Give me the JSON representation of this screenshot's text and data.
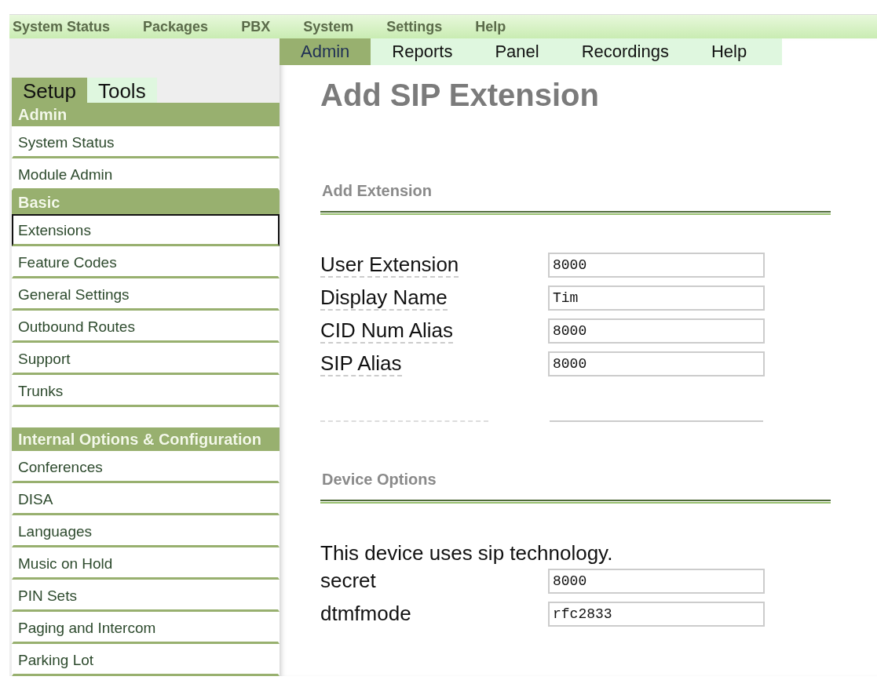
{
  "top_menu": [
    {
      "label": "System Status"
    },
    {
      "label": "Packages"
    },
    {
      "label": "PBX"
    },
    {
      "label": "System"
    },
    {
      "label": "Settings"
    },
    {
      "label": "Help"
    }
  ],
  "sub_menu": [
    {
      "label": "Admin",
      "selected": true
    },
    {
      "label": "Reports",
      "selected": false
    },
    {
      "label": "Panel",
      "selected": false
    },
    {
      "label": "Recordings",
      "selected": false
    },
    {
      "label": "Help",
      "selected": false
    }
  ],
  "sidebar": {
    "tabs": [
      {
        "label": "Setup",
        "selected": true
      },
      {
        "label": "Tools",
        "selected": false
      }
    ],
    "groups": [
      {
        "title": "Admin",
        "items": [
          {
            "label": "System Status",
            "selected": false
          },
          {
            "label": "Module Admin",
            "selected": false
          }
        ]
      },
      {
        "title": "Basic",
        "items": [
          {
            "label": "Extensions",
            "selected": true
          },
          {
            "label": "Feature Codes",
            "selected": false
          },
          {
            "label": "General Settings",
            "selected": false
          },
          {
            "label": "Outbound Routes",
            "selected": false
          },
          {
            "label": "Support",
            "selected": false
          },
          {
            "label": "Trunks",
            "selected": false
          }
        ]
      },
      {
        "title": "Internal Options & Configuration",
        "items": [
          {
            "label": "Conferences",
            "selected": false
          },
          {
            "label": "DISA",
            "selected": false
          },
          {
            "label": "Languages",
            "selected": false
          },
          {
            "label": "Music on Hold",
            "selected": false
          },
          {
            "label": "PIN Sets",
            "selected": false
          },
          {
            "label": "Paging and Intercom",
            "selected": false
          },
          {
            "label": "Parking Lot",
            "selected": false
          }
        ]
      }
    ]
  },
  "page_title": "Add SIP Extension",
  "sections": [
    {
      "title": "Add Extension",
      "fields": [
        {
          "label": "User Extension",
          "value": "8000",
          "help": true
        },
        {
          "label": "Display Name",
          "value": "Tim",
          "help": true
        },
        {
          "label": "CID Num Alias",
          "value": "8000",
          "help": true
        },
        {
          "label": "SIP Alias",
          "value": "8000",
          "help": true
        }
      ]
    },
    {
      "title": "Device Options",
      "note": "This device uses sip technology.",
      "fields": [
        {
          "label": "secret",
          "value": "8000",
          "help": false
        },
        {
          "label": "dtmfmode",
          "value": "rfc2833",
          "help": false
        }
      ]
    }
  ]
}
